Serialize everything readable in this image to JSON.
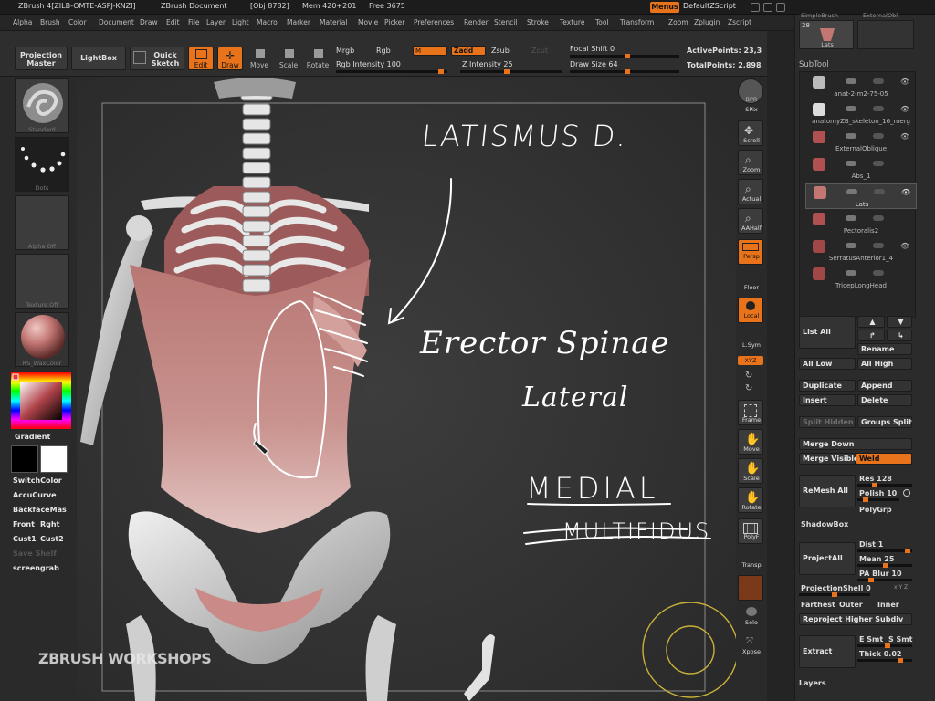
{
  "title_bar": {
    "app": "ZBrush 4[ZILB-OMTE-ASPJ-KNZI]",
    "document": "ZBrush Document",
    "obj": "[Obj 8782]",
    "mem": "Mem 420+201",
    "free": "Free 3675",
    "menus_button": "Menus",
    "script_button": "DefaultZScript"
  },
  "menu_bar": [
    "Alpha",
    "Brush",
    "Color",
    "Document",
    "Draw",
    "Edit",
    "File",
    "Layer",
    "Light",
    "Macro",
    "Marker",
    "Material",
    "Movie",
    "Picker",
    "Preferences",
    "Render",
    "Stencil",
    "Stroke",
    "Texture",
    "Tool",
    "Transform",
    "Zoom",
    "Zplugin",
    "Zscript"
  ],
  "toolbar": {
    "projection_master": "Projection Master",
    "lightbox": "LightBox",
    "quick_sketch": "Quick Sketch",
    "edit": "Edit",
    "draw": "Draw",
    "move": "Move",
    "scale": "Scale",
    "rotate": "Rotate",
    "mrgb": "Mrgb",
    "rgb": "Rgb",
    "m": "M",
    "zadd": "Zadd",
    "zsub": "Zsub",
    "zcut": "Zcut",
    "rgb_intensity": "Rgb Intensity 100",
    "z_intensity": "Z Intensity 25",
    "focal_shift": "Focal Shift 0",
    "draw_size": "Draw Size 64",
    "active_points": "ActivePoints: 23,3",
    "total_points": "TotalPoints: 2.898"
  },
  "left_shelf": {
    "brush_caption": "Standard",
    "stroke_caption": "Dots",
    "alpha_caption": "Alpha Off",
    "texture_caption": "Texture Off",
    "material_caption": "RS_WaxColor",
    "gradient": "Gradient",
    "switch_color": "SwitchColor",
    "accu_curve": "AccuCurve",
    "backface_mask": "BackfaceMas",
    "front": "Front",
    "right": "Rght",
    "cust1": "Cust1",
    "cust2": "Cust2",
    "save_shelf": "Save Shelf",
    "screengrab": "screengrab"
  },
  "right_shelf": [
    "BPR",
    "SPix",
    "Scroll",
    "Zoom",
    "Actual",
    "AAHalf",
    "Persp",
    "Floor",
    "Local",
    "L.Sym",
    "XYZ",
    "",
    "",
    "Frame",
    "Move",
    "Scale",
    "Rotate",
    "PolyF",
    "Transp",
    "Ghost",
    "Solo",
    "Xpose"
  ],
  "canvas": {
    "annotations": [
      "LATISMUS D.",
      "Erector Spinae",
      "Lateral",
      "MEDIAL",
      "MULTIFIDUS"
    ],
    "watermark": "ZBRUSH WORKSHOPS"
  },
  "subtool": {
    "header": "SubTool",
    "top_thumb_count": "28",
    "top_thumb_label": "Lats",
    "top_label_left": "SimpleBrush",
    "top_label_right": "ExternalObl",
    "items": [
      "anat-2-m2-75-05",
      "anatomyZB_skeleton_16_merg",
      "ExternalOblique",
      "Abs_1",
      "Lats",
      "Pectoralis2",
      "SerratusAnterior1_4",
      "TricepLongHead"
    ],
    "active_item": "Lats",
    "list_all": "List All",
    "rename": "Rename",
    "all_low": "All Low",
    "all_high": "All High",
    "duplicate": "Duplicate",
    "append": "Append",
    "insert": "Insert",
    "delete": "Delete",
    "split_hidden": "Split Hidden",
    "groups_split": "Groups Split",
    "merge_down": "Merge Down",
    "merge_visible": "Merge Visible",
    "weld": "Weld",
    "remesh_all": "ReMesh All",
    "res": "Res 128",
    "polish": "Polish 10",
    "polygrp": "PolyGrp",
    "shadowbox": "ShadowBox",
    "project_all": "ProjectAll",
    "dist": "Dist 1",
    "mean": "Mean 25",
    "pa_blur": "PA Blur 10",
    "projection_shell": "ProjectionShell 0",
    "xyz_small": "x Y Z",
    "farthest": "Farthest",
    "outer": "Outer",
    "inner": "Inner",
    "reproject": "Reproject Higher Subdiv",
    "extract": "Extract",
    "e_smt": "E Smt",
    "s_smt": "S Smt",
    "thick": "Thick 0.02",
    "layers": "Layers"
  },
  "colors": {
    "accent_orange": "#e8731a",
    "panel_bg": "#2b2b2b",
    "muscle_pink": "#b86b6b"
  }
}
